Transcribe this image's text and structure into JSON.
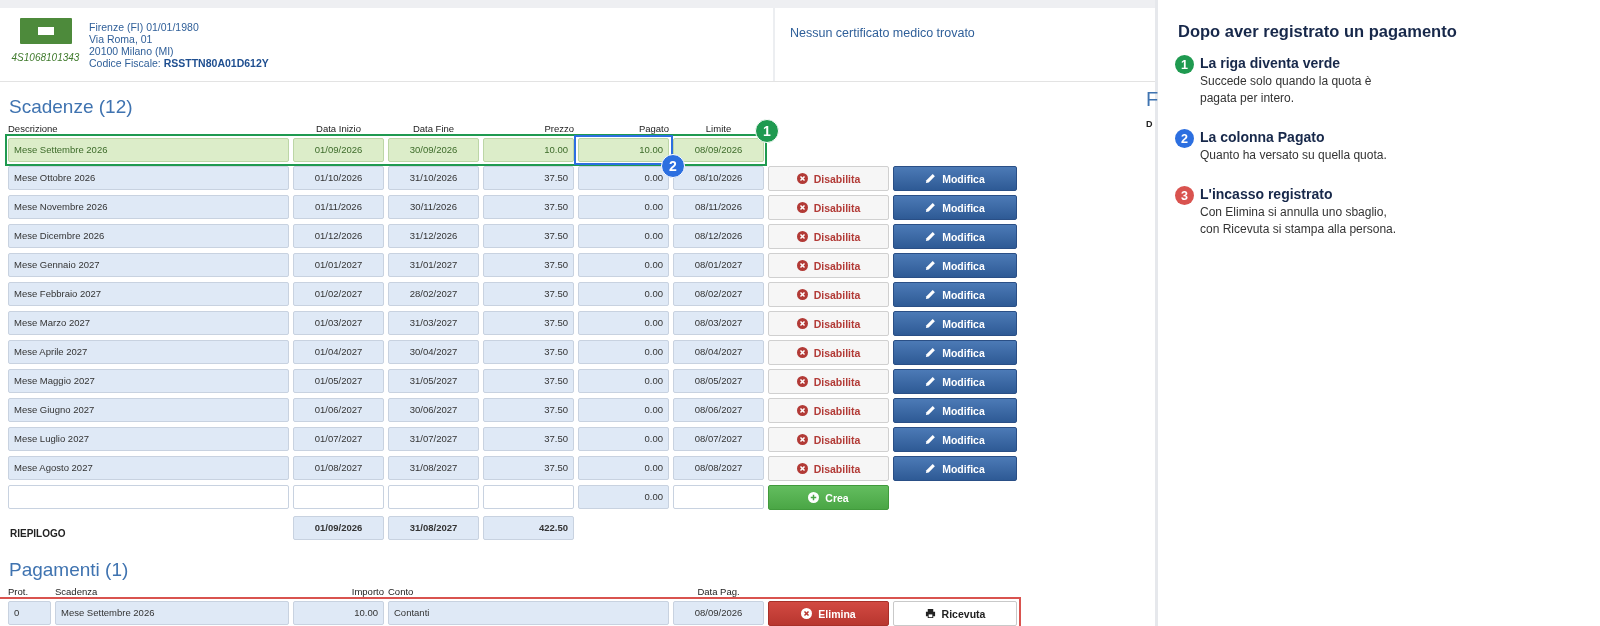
{
  "person": {
    "birth": "Firenze (FI) 01/01/1980",
    "address": "Via Roma, 01",
    "city": "20100 Milano (MI)",
    "tax_code_label": "Codice Fiscale:",
    "tax_code": "RSSTTN80A01D612Y",
    "card_number": "4S1068101343"
  },
  "certificate": {
    "message": "Nessun certificato medico trovato"
  },
  "scadenze": {
    "title": "Scadenze (12)",
    "columns": [
      "Descrizione",
      "Data Inizio",
      "Data Fine",
      "Prezzo",
      "Pagato",
      "Limite"
    ],
    "rows": [
      {
        "description": "Mese Settembre 2026",
        "start": "01/09/2026",
        "end": "30/09/2026",
        "price": "10.00",
        "paid_amount": "10.00",
        "limit": "08/09/2026",
        "paid": true
      },
      {
        "description": "Mese Ottobre 2026",
        "start": "01/10/2026",
        "end": "31/10/2026",
        "price": "37.50",
        "paid_amount": "0.00",
        "limit": "08/10/2026",
        "paid": false,
        "disable_label": "Disabilita",
        "edit_label": "Modifica"
      },
      {
        "description": "Mese Novembre 2026",
        "start": "01/11/2026",
        "end": "30/11/2026",
        "price": "37.50",
        "paid_amount": "0.00",
        "limit": "08/11/2026",
        "paid": false,
        "disable_label": "Disabilita",
        "edit_label": "Modifica"
      },
      {
        "description": "Mese Dicembre 2026",
        "start": "01/12/2026",
        "end": "31/12/2026",
        "price": "37.50",
        "paid_amount": "0.00",
        "limit": "08/12/2026",
        "paid": false,
        "disable_label": "Disabilita",
        "edit_label": "Modifica"
      },
      {
        "description": "Mese Gennaio 2027",
        "start": "01/01/2027",
        "end": "31/01/2027",
        "price": "37.50",
        "paid_amount": "0.00",
        "limit": "08/01/2027",
        "paid": false,
        "disable_label": "Disabilita",
        "edit_label": "Modifica"
      },
      {
        "description": "Mese Febbraio 2027",
        "start": "01/02/2027",
        "end": "28/02/2027",
        "price": "37.50",
        "paid_amount": "0.00",
        "limit": "08/02/2027",
        "paid": false,
        "disable_label": "Disabilita",
        "edit_label": "Modifica"
      },
      {
        "description": "Mese Marzo 2027",
        "start": "01/03/2027",
        "end": "31/03/2027",
        "price": "37.50",
        "paid_amount": "0.00",
        "limit": "08/03/2027",
        "paid": false,
        "disable_label": "Disabilita",
        "edit_label": "Modifica"
      },
      {
        "description": "Mese Aprile 2027",
        "start": "01/04/2027",
        "end": "30/04/2027",
        "price": "37.50",
        "paid_amount": "0.00",
        "limit": "08/04/2027",
        "paid": false,
        "disable_label": "Disabilita",
        "edit_label": "Modifica"
      },
      {
        "description": "Mese Maggio 2027",
        "start": "01/05/2027",
        "end": "31/05/2027",
        "price": "37.50",
        "paid_amount": "0.00",
        "limit": "08/05/2027",
        "paid": false,
        "disable_label": "Disabilita",
        "edit_label": "Modifica"
      },
      {
        "description": "Mese Giugno 2027",
        "start": "01/06/2027",
        "end": "30/06/2027",
        "price": "37.50",
        "paid_amount": "0.00",
        "limit": "08/06/2027",
        "paid": false,
        "disable_label": "Disabilita",
        "edit_label": "Modifica"
      },
      {
        "description": "Mese Luglio 2027",
        "start": "01/07/2027",
        "end": "31/07/2027",
        "price": "37.50",
        "paid_amount": "0.00",
        "limit": "08/07/2027",
        "paid": false,
        "disable_label": "Disabilita",
        "edit_label": "Modifica"
      },
      {
        "description": "Mese Agosto 2027",
        "start": "01/08/2027",
        "end": "31/08/2027",
        "price": "37.50",
        "paid_amount": "0.00",
        "limit": "08/08/2027",
        "paid": false,
        "disable_label": "Disabilita",
        "edit_label": "Modifica"
      }
    ],
    "new_row": {
      "paid_amount": "0.00",
      "button": "Crea"
    },
    "summary": {
      "label": "RIEPILOGO",
      "start": "01/09/2026",
      "end": "31/08/2027",
      "total": "422.50"
    }
  },
  "pagamenti": {
    "title": "Pagamenti (1)",
    "columns": [
      "Prot.",
      "Scadenza",
      "Importo",
      "Conto",
      "Data Pag."
    ],
    "rows": [
      {
        "prot": "0",
        "scadenza": "Mese Settembre 2026",
        "importo": "10.00",
        "conto": "Contanti",
        "date": "08/09/2026",
        "delete_label": "Elimina",
        "receipt_label": "Ricevuta"
      }
    ]
  },
  "cut_column": {
    "heading": "F",
    "label": "D"
  },
  "callouts": [
    {
      "kind": "row",
      "color": "#1f9a50",
      "badge": "1"
    },
    {
      "kind": "cell",
      "color": "#2c6fe0",
      "badge": "2"
    },
    {
      "kind": "payment",
      "color": "#d9534f"
    }
  ],
  "panel": {
    "title": "Dopo aver registrato un pagamento",
    "steps": [
      {
        "number": "1",
        "color": "#1f9a50",
        "title": "La riga diventa verde",
        "text": "Succede solo quando la quota è\npagata per intero."
      },
      {
        "number": "2",
        "color": "#2c6fe0",
        "title": "La colonna Pagato",
        "text": "Quanto ha versato su quella quota."
      },
      {
        "number": "3",
        "color": "#d9534f",
        "title": "L'incasso registrato",
        "text": "Con Elimina si annulla uno sbaglio,\ncon Ricevuta si stampa alla persona."
      }
    ]
  }
}
